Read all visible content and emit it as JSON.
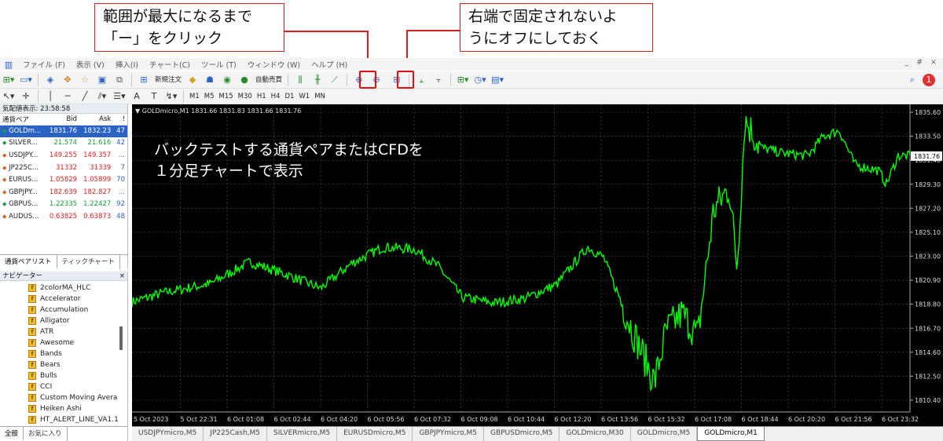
{
  "annotations": {
    "callout1": "範囲が最大になるまで\n「ー」をクリック",
    "callout2": "右端で固定されないよ\nうにオフにしておく",
    "chart_note": "バックテストする通貨ペアまたはCFDを\n１分足チャートで表示"
  },
  "menu": [
    "ファイル (F)",
    "表示 (V)",
    "挿入(I)",
    "チャート(C)",
    "ツール (T)",
    "ウィンドウ (W)",
    "ヘルプ (H)"
  ],
  "toolbar": {
    "new_order": "新規注文",
    "auto_trade": "自動売買"
  },
  "timeframes": [
    "M1",
    "M5",
    "M15",
    "M30",
    "H1",
    "H4",
    "D1",
    "W1",
    "MN"
  ],
  "market_watch": {
    "header": "気配値表示: 23:58:58",
    "columns": [
      "通貨ペア",
      "Bid",
      "Ask",
      "!"
    ],
    "rows": [
      {
        "sym": "GOLDm...",
        "bid": "1831.76",
        "ask": "1832.23",
        "spr": "47",
        "dir": "up",
        "sel": true
      },
      {
        "sym": "SILVER...",
        "bid": "21.574",
        "ask": "21.616",
        "spr": "42",
        "dir": "up"
      },
      {
        "sym": "USDJPY...",
        "bid": "149.255",
        "ask": "149.357",
        "spr": "...",
        "dir": "dn"
      },
      {
        "sym": "JP225C...",
        "bid": "31332",
        "ask": "31339",
        "spr": "7",
        "dir": "dn"
      },
      {
        "sym": "EURUS...",
        "bid": "1.05829",
        "ask": "1.05899",
        "spr": "70",
        "dir": "dn"
      },
      {
        "sym": "GBPJPY...",
        "bid": "182.639",
        "ask": "182.827",
        "spr": "...",
        "dir": "dn"
      },
      {
        "sym": "GBPUS...",
        "bid": "1.22335",
        "ask": "1.22427",
        "spr": "92",
        "dir": "up"
      },
      {
        "sym": "AUDUS...",
        "bid": "0.63825",
        "ask": "0.63873",
        "spr": "48",
        "dir": "dn"
      }
    ],
    "tabs": [
      "通貨ペアリスト",
      "ティックチャート"
    ]
  },
  "navigator": {
    "header": "ナビゲーター",
    "items": [
      "2colorMA_HLC",
      "Accelerator",
      "Accumulation",
      "Alligator",
      "ATR",
      "Awesome",
      "Bands",
      "Bears",
      "Bulls",
      "CCI",
      "Custom Moving Avera",
      "Heiken Ashi",
      "HT_ALERT_LINE_VA1.1"
    ],
    "tabs": [
      "全般",
      "お気に入り"
    ]
  },
  "chart": {
    "info": "▼ GOLDmicro,M1  1831.66 1831.83 1831.66 1831.76",
    "price_labels": [
      "1835.60",
      "1833.50",
      "1831.40",
      "1829.30",
      "1827.20",
      "1825.10",
      "1823.00",
      "1820.90",
      "1818.80",
      "1816.70",
      "1814.60",
      "1812.50",
      "1810.40"
    ],
    "current_price": "1831.76",
    "time_labels": [
      "5 Oct 2023",
      "5 Oct 22:31",
      "6 Oct 01:08",
      "6 Oct 02:44",
      "6 Oct 04:20",
      "6 Oct 05:56",
      "6 Oct 07:32",
      "6 Oct 09:08",
      "6 Oct 10:44",
      "6 Oct 12:20",
      "6 Oct 13:56",
      "6 Oct 15:32",
      "6 Oct 17:08",
      "6 Oct 18:44",
      "6 Oct 20:20",
      "6 Oct 21:56",
      "6 Oct 23:32"
    ],
    "line_color": "#00ff00",
    "chart_tabs": [
      "USDJPYmicro,M5",
      "JP225Cash,M5",
      "SILVERmicro,M5",
      "EURUSDmicro,M5",
      "GBPJPYmicro,M5",
      "GBPUSDmicro,M5",
      "GOLDmicro,M30",
      "GOLDmicro,M5",
      "GOLDmicro,M1"
    ]
  }
}
